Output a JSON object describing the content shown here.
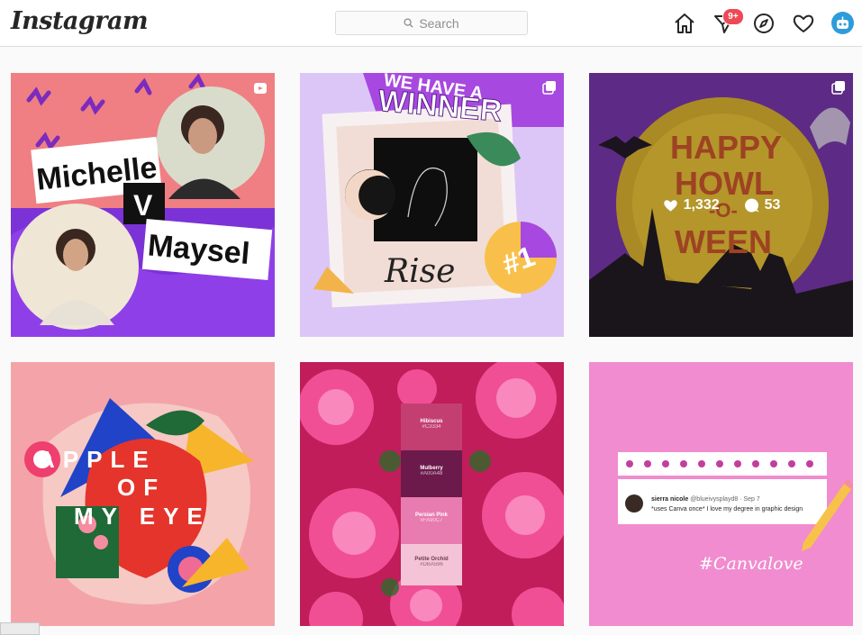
{
  "header": {
    "logo": "Instagram",
    "search_placeholder": "Search",
    "notification_badge": "9+"
  },
  "posts": [
    {
      "title": "Michelle V Maysel",
      "left": "Michelle",
      "vs": "V",
      "right": "Maysel"
    },
    {
      "heading": "WE HAVE A WINNER",
      "line1": "WE HAVE A",
      "line2": "WINNER",
      "caption": "Rise",
      "tag": "#1"
    },
    {
      "line1": "HAPPY",
      "line2": "HOWL",
      "line3": "-O-",
      "line4": "WEEN",
      "likes": "1,332",
      "comments": "53"
    },
    {
      "line1": "APPLE",
      "line2": "OF",
      "line3": "MY EYE"
    },
    {
      "swatches": [
        {
          "name": "Hibiscus",
          "code": "#C3334"
        },
        {
          "name": "Mulberry",
          "code": "#A00A48"
        },
        {
          "name": "Persian Pink",
          "code": "#FA90C7"
        },
        {
          "name": "Petite Orchid",
          "code": "#DBA596"
        }
      ]
    },
    {
      "tweet_name": "sierra nicole",
      "tweet_handle": "@blueivysplayd8 · Sep 7",
      "tweet_text": "*uses Canva once* I love my degree in graphic design",
      "hashtag": "#Canvalove"
    }
  ],
  "colors": {
    "accent": "#ed4956",
    "border": "#dbdbdb",
    "avatar": "#2d9cdb"
  }
}
